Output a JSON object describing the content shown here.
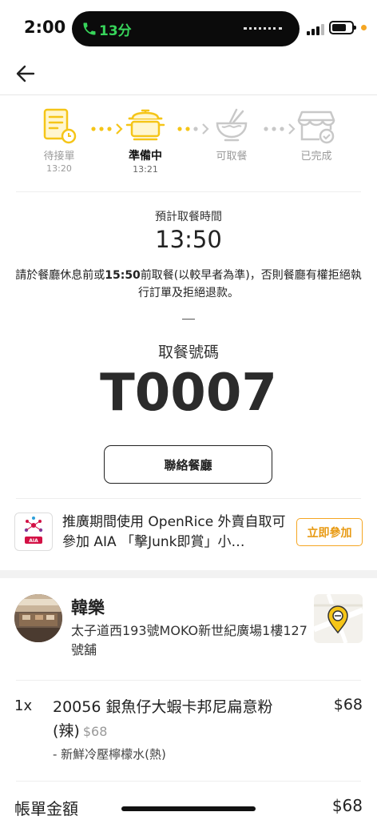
{
  "status_bar": {
    "time": "2:00",
    "call_duration": "13分"
  },
  "progress": {
    "steps": [
      {
        "label": "待接單",
        "time": "13:20",
        "state": "done",
        "icon": "order-receipt-icon"
      },
      {
        "label": "準備中",
        "time": "13:21",
        "state": "active",
        "icon": "cooking-pot-icon"
      },
      {
        "label": "可取餐",
        "time": "",
        "state": "pending",
        "icon": "noodle-bowl-icon"
      },
      {
        "label": "已完成",
        "time": "",
        "state": "pending",
        "icon": "store-check-icon"
      }
    ],
    "accent_color": "#f5c518"
  },
  "pickup": {
    "estimate_label": "預計取餐時間",
    "estimate_time": "13:50",
    "notice_pre": "請於餐廳休息前或",
    "notice_bold": "15:50",
    "notice_post": "前取餐(以較早者為準)，否則餐廳有權拒絕執行訂單及拒絕退款。",
    "number_label": "取餐號碼",
    "number": "T0007",
    "contact_button": "聯絡餐廳"
  },
  "promo": {
    "logo_text": "AIA",
    "text": "推廣期間使用 OpenRice 外賣自取可參加 AIA 「擊Junk即賞」小…",
    "button": "立即參加",
    "accent_color": "#f5a623"
  },
  "restaurant": {
    "name": "韓樂",
    "address": "太子道西193號MOKO新世紀廣場1樓127號舖"
  },
  "order": {
    "items": [
      {
        "qty": "1x",
        "name": "20056 銀魚仔大蝦卡邦尼扁意粉(辣)",
        "unit_price": "$68",
        "price": "$68",
        "option": "- 新鮮冷壓檸檬水(熱)"
      }
    ],
    "total_label": "帳單金額",
    "total": "$68"
  }
}
